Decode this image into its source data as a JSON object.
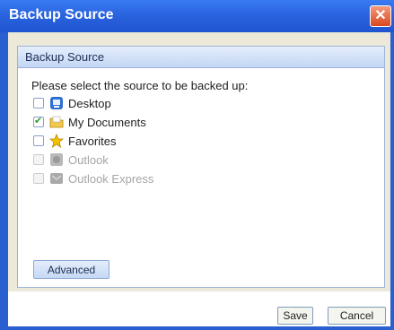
{
  "window": {
    "title": "Backup Source",
    "close_label": "✕"
  },
  "panel": {
    "header": "Backup Source",
    "prompt": "Please select the source to be backed up:",
    "items": [
      {
        "label": "Desktop",
        "checked": false,
        "enabled": true,
        "icon": "desktop-icon"
      },
      {
        "label": "My Documents",
        "checked": true,
        "enabled": true,
        "icon": "folder-icon"
      },
      {
        "label": "Favorites",
        "checked": false,
        "enabled": true,
        "icon": "star-icon"
      },
      {
        "label": "Outlook",
        "checked": false,
        "enabled": false,
        "icon": "outlook-icon"
      },
      {
        "label": "Outlook Express",
        "checked": false,
        "enabled": false,
        "icon": "outlook-express-icon"
      }
    ],
    "advanced_label": "Advanced"
  },
  "footer": {
    "save_label": "Save",
    "cancel_label": "Cancel"
  },
  "colors": {
    "titlebar": "#2b64e0",
    "panel_header": "#c3d6f5",
    "client": "#ece9d8"
  }
}
